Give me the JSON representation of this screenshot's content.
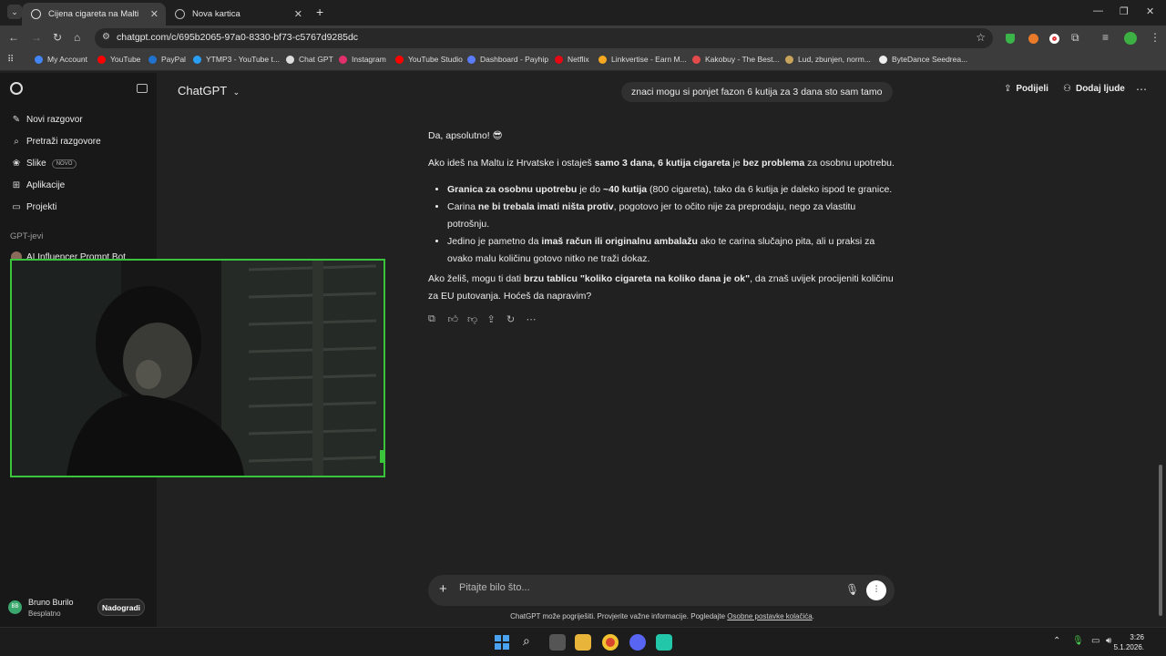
{
  "browser": {
    "tabs": [
      {
        "label": "Cijena cigareta na Malti",
        "active": true
      },
      {
        "label": "Nova kartica",
        "active": false
      }
    ],
    "url": "chatgpt.com/c/695b2065-97a0-8330-bf73-c5767d9285dc",
    "bookmarks": [
      {
        "label": "My Account",
        "color": "#4285f4"
      },
      {
        "label": "YouTube",
        "color": "#ff0000"
      },
      {
        "label": "PayPal",
        "color": "#1f72cd"
      },
      {
        "label": "YTMP3 - YouTube t...",
        "color": "#2a9df4"
      },
      {
        "label": "Chat GPT",
        "color": "#dddddd"
      },
      {
        "label": "Instagram",
        "color": "#e1306c"
      },
      {
        "label": "YouTube Studio",
        "color": "#ff0000"
      },
      {
        "label": "Dashboard - Payhip",
        "color": "#5b7cfa"
      },
      {
        "label": "Netflix",
        "color": "#e50914"
      },
      {
        "label": "Linkvertise - Earn M...",
        "color": "#f6a821"
      },
      {
        "label": "Kakobuy - The Best...",
        "color": "#e34b4b"
      },
      {
        "label": "Lud, zbunjen, norm...",
        "color": "#c8a35b"
      },
      {
        "label": "ByteDance Seedrea...",
        "color": "#eeeeee"
      }
    ]
  },
  "sidebar": {
    "items": [
      {
        "label": "Novi razgovor",
        "icon": "edit-icon"
      },
      {
        "label": "Pretraži razgovore",
        "icon": "search-icon"
      },
      {
        "label": "Slike",
        "icon": "image-icon",
        "badge": "NOVO"
      },
      {
        "label": "Aplikacije",
        "icon": "apps-icon"
      },
      {
        "label": "Projekti",
        "icon": "folder-icon"
      }
    ],
    "section_label": "GPT-jevi",
    "gpt_item": "AI Influencer Prompt Bot",
    "user": {
      "initials": "BB",
      "name": "Bruno Burilo",
      "plan": "Besplatno",
      "upgrade_label": "Nadogradi"
    }
  },
  "chat": {
    "model_label": "ChatGPT",
    "share_label": "Podijeli",
    "add_people_label": "Dodaj ljude",
    "user_message": "znaci mogu si ponjet fazon 6 kutija za 3 dana sto sam tamo",
    "answer": {
      "greeting": "Da, apsolutno! 😎",
      "p1_a": "Ako ideš na Maltu iz Hrvatske i ostaješ ",
      "p1_b1": "samo 3 dana",
      "p1_c": ", ",
      "p1_b2": "6 kutija cigareta",
      "p1_d": " je ",
      "p1_b3": "bez problema",
      "p1_e": " za osobnu upotrebu.",
      "li1_b1": "Granica za osobnu upotrebu",
      "li1_a": " je do ",
      "li1_b2": "~40 kutija",
      "li1_c": " (800 cigareta), tako da 6 kutija je daleko ispod te granice.",
      "li2_a": "Carina ",
      "li2_b": "ne bi trebala imati ništa protiv",
      "li2_c": ", pogotovo jer to očito nije za preprodaju, nego za vlastitu potrošnju.",
      "li3_a": "Jedino je pametno da ",
      "li3_b": "imaš račun ili originalnu ambalažu",
      "li3_c": " ako te carina slučajno pita, ali u praksi za ovako malu količinu gotovo nitko ne traži dokaz.",
      "p2_a": "Ako želiš, mogu ti dati ",
      "p2_b": "brzu tablicu \"koliko cigareta na koliko dana je ok\"",
      "p2_c": ", da znaš uvijek procijeniti količinu za EU putovanja. Hoćeš da napravim?"
    },
    "composer_placeholder": "Pitajte bilo što...",
    "footnote_text": "ChatGPT može pogriješiti. Provjerite važne informacije. Pogledajte ",
    "footnote_link": "Osobne postavke kolačića",
    "footnote_end": "."
  },
  "taskbar": {
    "time": "3:26",
    "date": "5.1.2026."
  }
}
